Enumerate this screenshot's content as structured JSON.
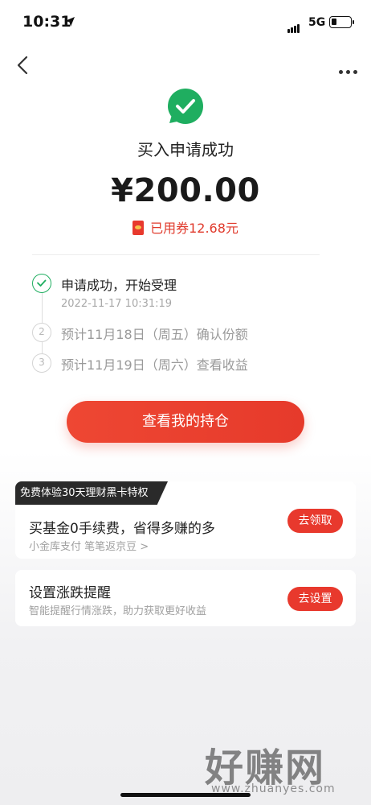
{
  "status_bar": {
    "time": "10:31",
    "network": "5G",
    "icons": [
      "location-arrow-icon",
      "signal-icon",
      "battery-icon"
    ]
  },
  "nav": {
    "back_icon": "chevron-left-icon",
    "more_icon": "more-dots-icon"
  },
  "result": {
    "icon": "check-circle-icon",
    "title": "买入申请成功",
    "amount": "¥200.00",
    "coupon_text": "已用券12.68元",
    "coupon_icon": "red-envelope-icon"
  },
  "steps": [
    {
      "number": "",
      "text": "申请成功，开始受理",
      "time": "2022-11-17 10:31:19",
      "state": "done"
    },
    {
      "number": "2",
      "text": "预计11月18日（周五）确认份额",
      "state": "pending"
    },
    {
      "number": "3",
      "text": "预计11月19日（周六）查看收益",
      "state": "pending"
    }
  ],
  "primary_button": "查看我的持仓",
  "cards": [
    {
      "tag": "免费体验30天理财黑卡特权",
      "title": "买基金0手续费，省得多赚的多",
      "subtitle": "小金库支付 笔笔返京豆 >",
      "button": "去领取"
    },
    {
      "title": "设置涨跌提醒",
      "subtitle": "智能提醒行情涨跌，助力获取更好收益",
      "button": "去设置"
    }
  ],
  "watermark": {
    "big": "好赚网",
    "small": "www.zhuanyes.com"
  },
  "colors": {
    "accent_red": "#e8392d",
    "success_green": "#1fae60"
  }
}
